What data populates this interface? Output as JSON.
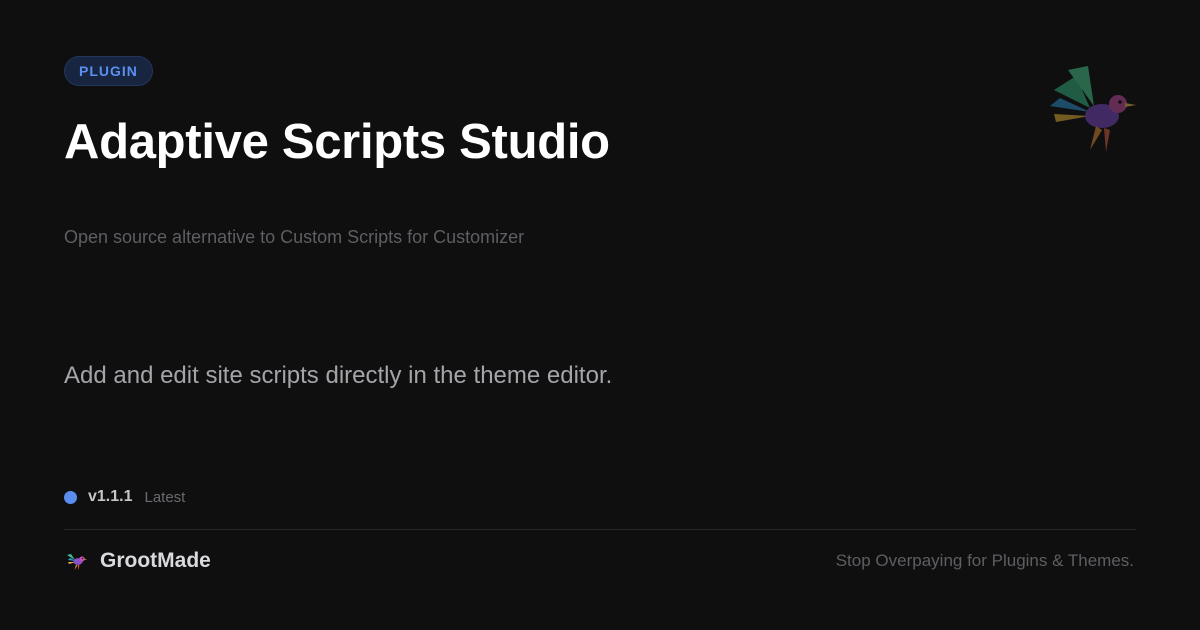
{
  "badge": {
    "label": "PLUGIN"
  },
  "title": "Adaptive Scripts Studio",
  "subtitle": "Open source alternative to Custom Scripts for Customizer",
  "description": "Add and edit site scripts directly in the theme editor.",
  "version": {
    "number": "v1.1.1",
    "tag": "Latest"
  },
  "brand": {
    "name": "GrootMade",
    "logo_icon": "bird-logo-icon"
  },
  "tagline": "Stop Overpaying for Plugins & Themes.",
  "decoration": {
    "mascot_icon": "hummingbird-icon"
  },
  "colors": {
    "background": "#0f0f10",
    "accent": "#5b8def",
    "badge_bg": "#172540"
  }
}
